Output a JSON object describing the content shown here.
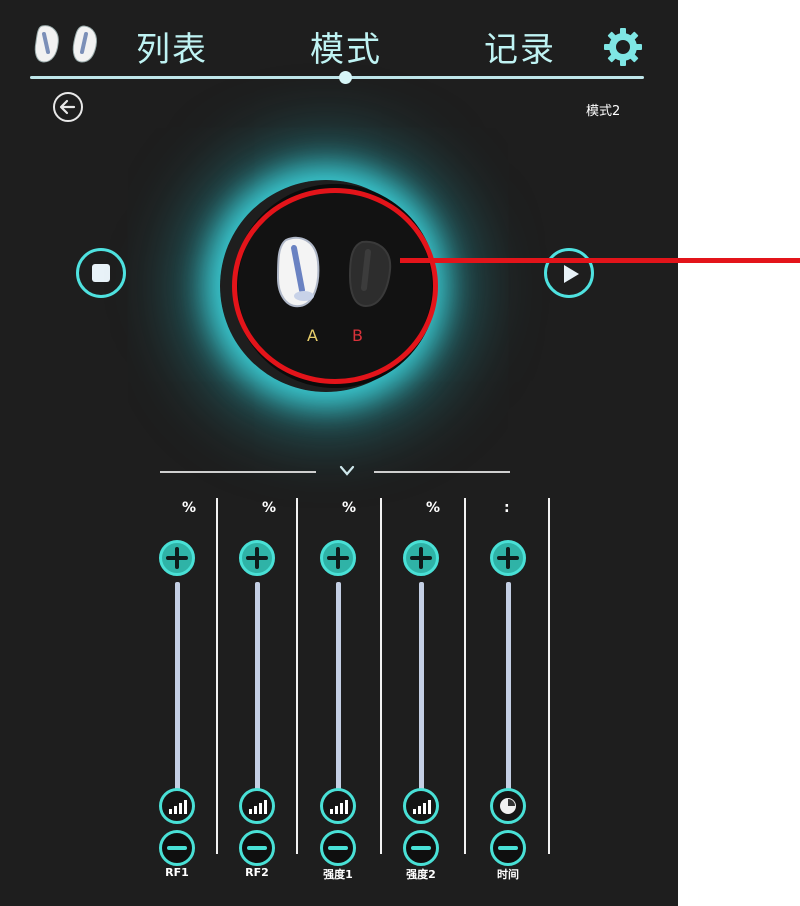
{
  "header": {
    "tabs": [
      {
        "label": "列表"
      },
      {
        "label": "模式"
      },
      {
        "label": "记录"
      }
    ],
    "active_tab": "模式"
  },
  "mode_label": "模式2",
  "device": {
    "label_a": "A",
    "label_b": "B"
  },
  "sliders": [
    {
      "label": "RF1",
      "unit": "%",
      "level": 0
    },
    {
      "label": "RF2",
      "unit": "%",
      "level": 0
    },
    {
      "label": "强度1",
      "unit": "%",
      "level": 0
    },
    {
      "label": "强度2",
      "unit": "%",
      "level": 0
    },
    {
      "label": "时间",
      "unit": ":",
      "level": 0
    }
  ],
  "colors": {
    "accent": "#49e0d6",
    "glow": "#40dee6",
    "highlight_ring": "#e3141a",
    "background": "#1e1e1e"
  }
}
